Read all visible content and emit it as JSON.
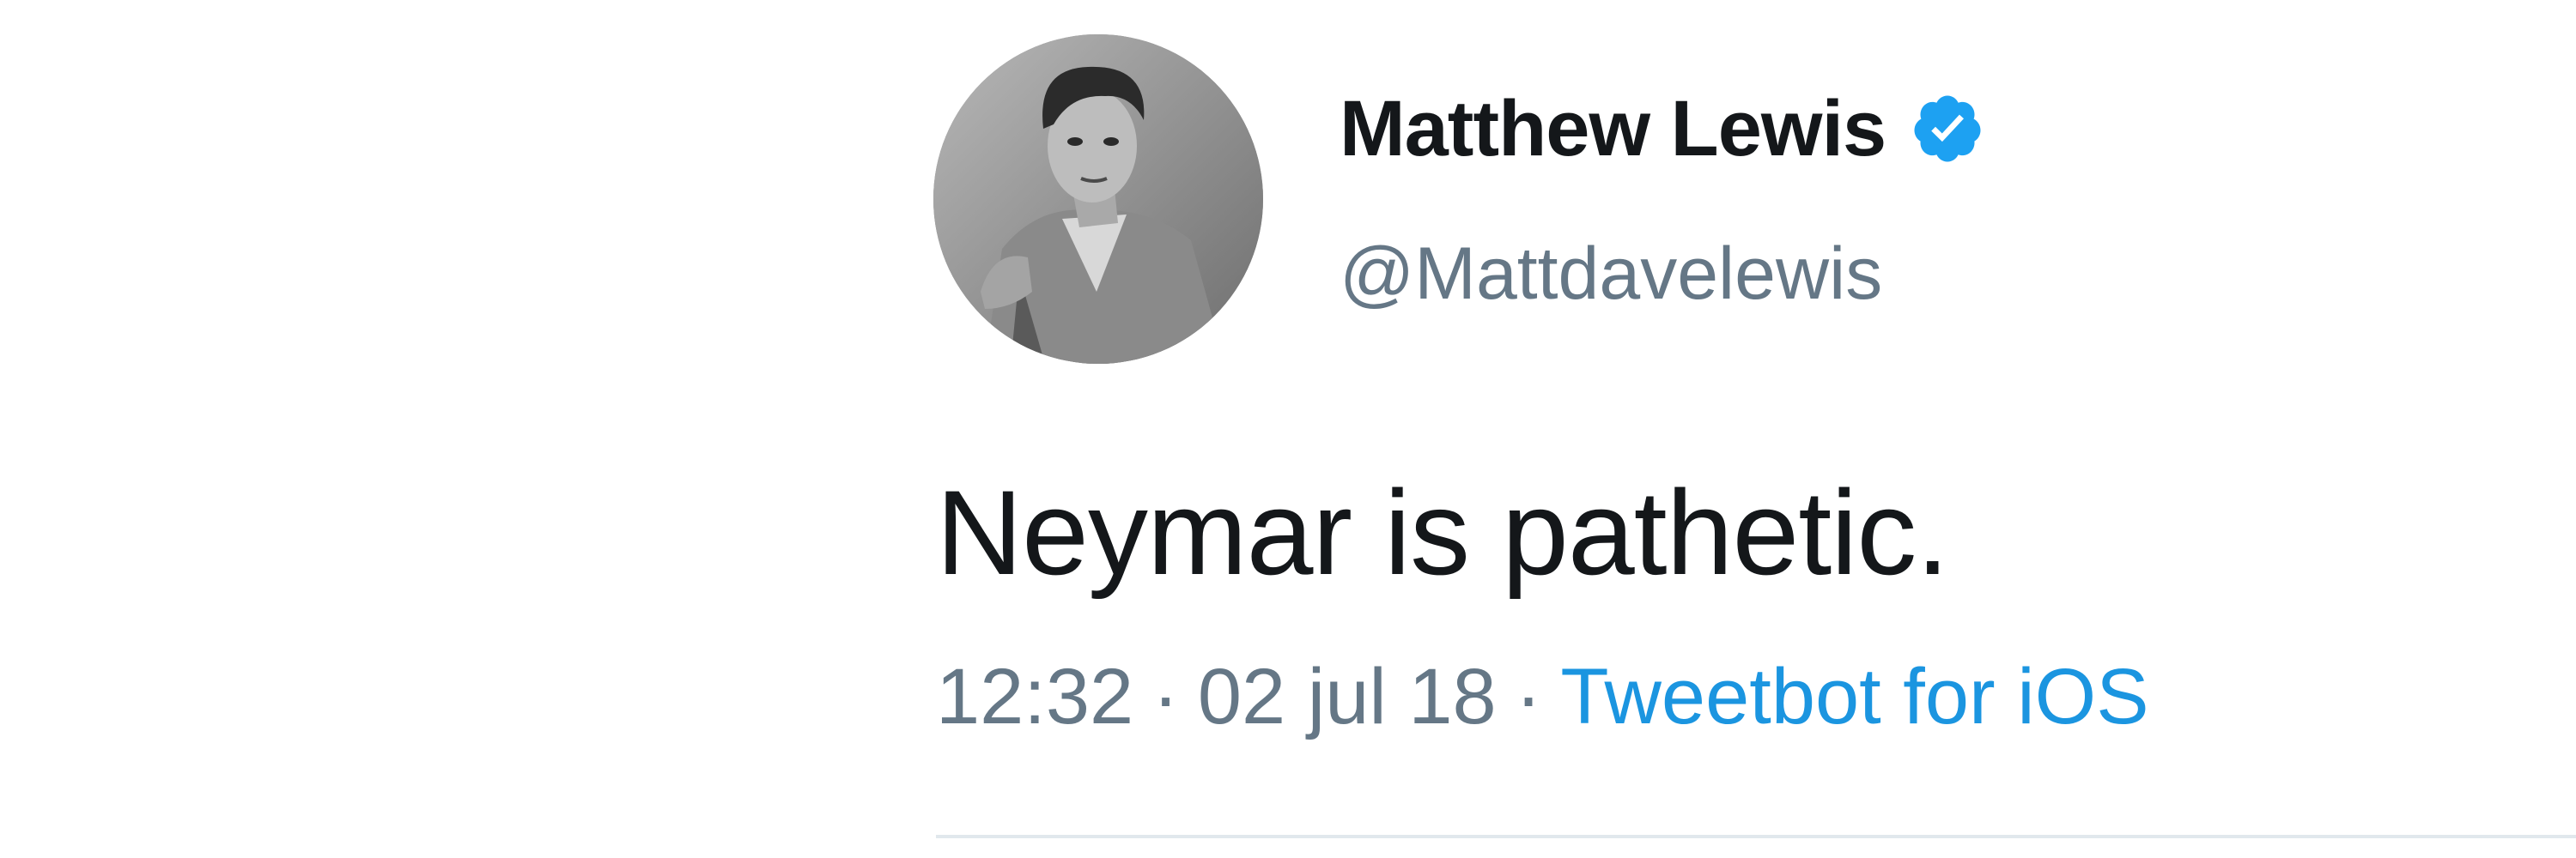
{
  "tweet": {
    "author": {
      "display_name": "Matthew Lewis",
      "handle": "@Mattdavelewis",
      "verified": true,
      "avatar_icon": "profile-photo"
    },
    "text": "Neymar is pathetic.",
    "meta": {
      "time": "12:32",
      "separator": "·",
      "date": "02 jul 18",
      "source": "Tweetbot for iOS"
    }
  },
  "colors": {
    "name_text": "#14171a",
    "secondary_text": "#657786",
    "link": "#1b95e0",
    "verified_badge": "#1da1f2",
    "divider": "#e1e8ed"
  }
}
